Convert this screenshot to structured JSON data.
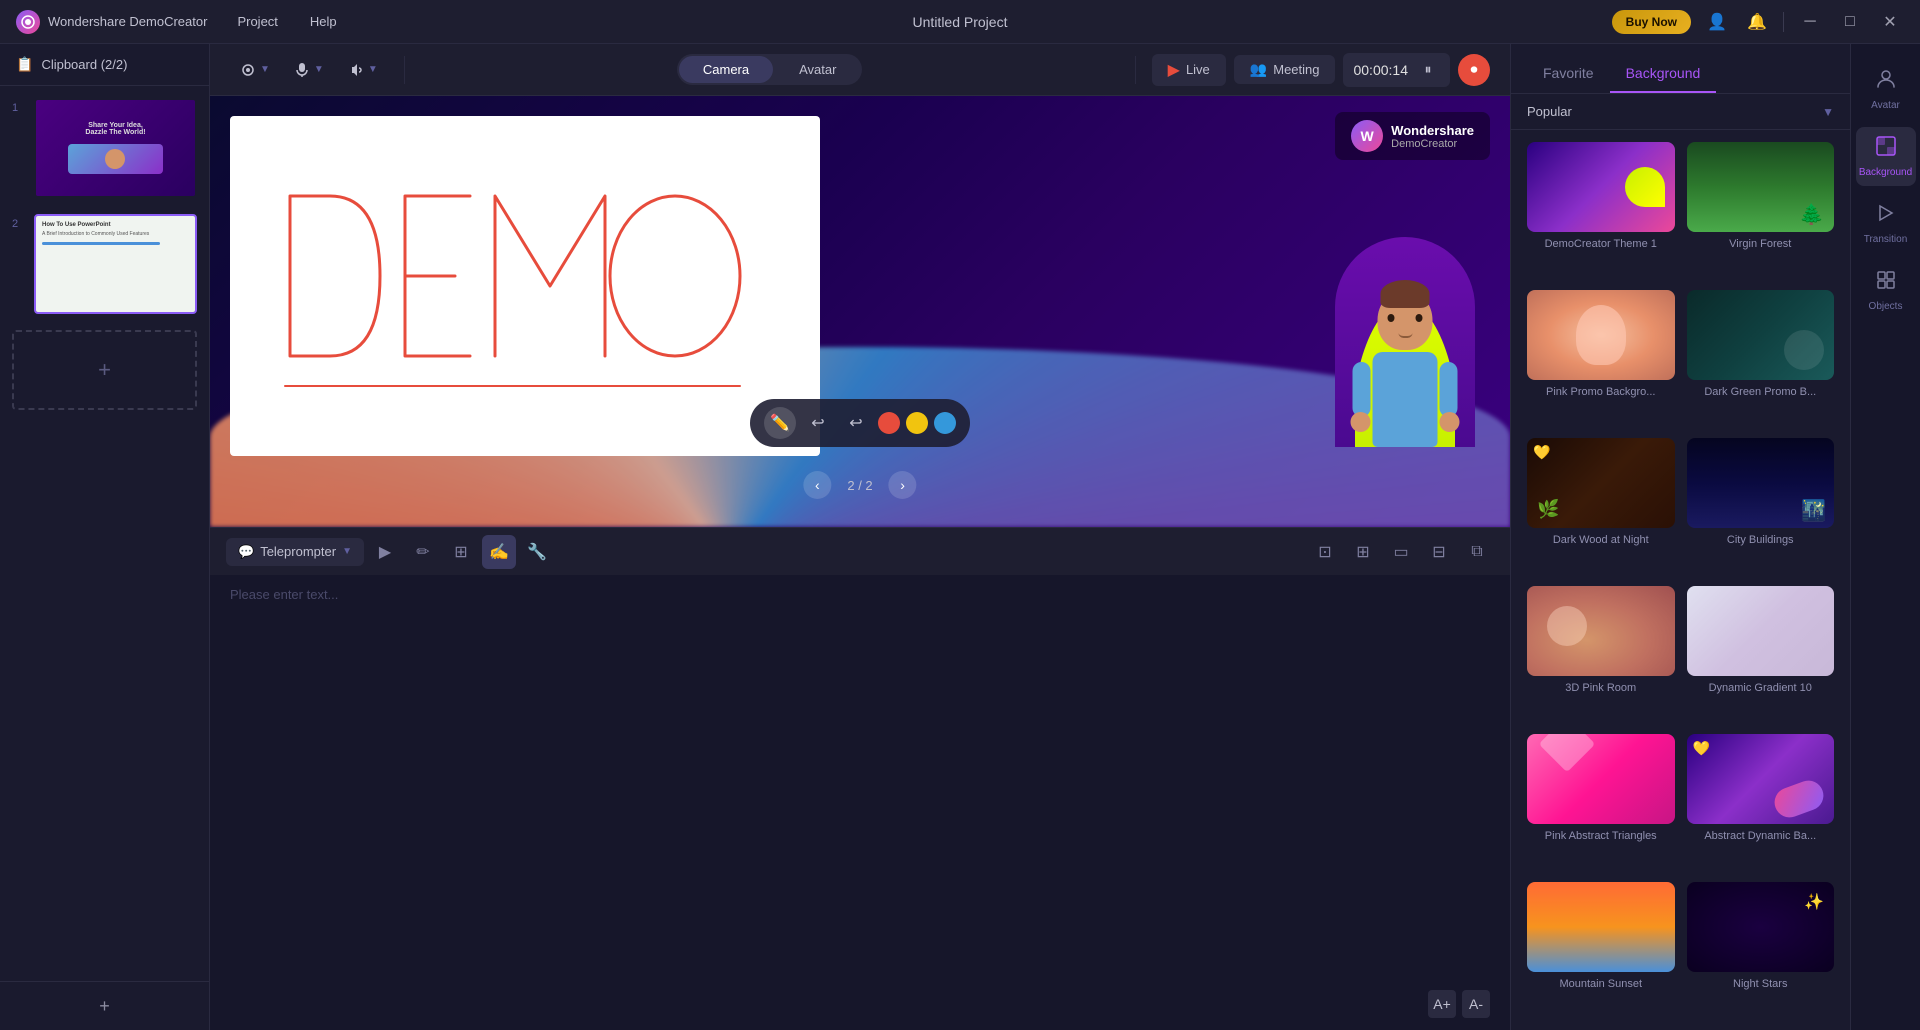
{
  "app": {
    "name": "Wondershare DemoCreator",
    "title": "Untitled Project",
    "logo_letter": "W"
  },
  "titlebar": {
    "menu": [
      "Project",
      "Help"
    ],
    "buy_label": "Buy Now",
    "window_buttons": [
      "minimize",
      "maximize",
      "close"
    ]
  },
  "toolbar": {
    "camera_label": "Camera",
    "avatar_label": "Avatar",
    "live_label": "Live",
    "meeting_label": "Meeting",
    "timer": "00:00:14"
  },
  "clipboard": {
    "title": "Clipboard (2/2)"
  },
  "slides": [
    {
      "num": "1",
      "title": "Share Your Idea, Dazzle The World!",
      "active": false
    },
    {
      "num": "2",
      "title": "How To Use PowerPoint",
      "active": true
    }
  ],
  "canvas": {
    "slide_counter": "2 / 2",
    "democreator_watermark_line1": "Wondershare",
    "democreator_watermark_line2": "DemoCreator"
  },
  "drawing_tools": {
    "tools": [
      "pen",
      "undo",
      "undo2"
    ],
    "colors": [
      "red",
      "yellow",
      "blue"
    ]
  },
  "teleprompter": {
    "label": "Teleprompter",
    "placeholder": "Please enter text...",
    "tools": [
      "pointer",
      "pen",
      "crop",
      "draw",
      "stamp"
    ]
  },
  "right_panel": {
    "tabs": [
      "Favorite",
      "Background"
    ],
    "active_tab": "Background",
    "dropdown_label": "Popular",
    "backgrounds": [
      {
        "id": "democreator-theme",
        "label": "DemoCreator Theme 1",
        "style": "democreator"
      },
      {
        "id": "virgin-forest",
        "label": "Virgin Forest",
        "style": "virgin-forest"
      },
      {
        "id": "pink-promo",
        "label": "Pink Promo Backgro...",
        "style": "pink-promo"
      },
      {
        "id": "dark-green-promo",
        "label": "Dark Green Promo B...",
        "style": "dark-green"
      },
      {
        "id": "dark-wood",
        "label": "Dark Wood at Night",
        "style": "dark-wood",
        "favorite": true
      },
      {
        "id": "city-buildings",
        "label": "City Buildings",
        "style": "city-buildings"
      },
      {
        "id": "3d-pink-room",
        "label": "3D Pink Room",
        "style": "3d-pink"
      },
      {
        "id": "dynamic-gradient",
        "label": "Dynamic Gradient 10",
        "style": "dynamic-gradient"
      },
      {
        "id": "pink-abstract",
        "label": "Pink Abstract Triangles",
        "style": "pink-abstract"
      },
      {
        "id": "abstract-dynamic",
        "label": "Abstract Dynamic Ba...",
        "style": "abstract-dynamic",
        "favorite": true
      },
      {
        "id": "mountain",
        "label": "Mountain Sunset",
        "style": "mountain"
      },
      {
        "id": "stars",
        "label": "Night Stars",
        "style": "stars"
      }
    ]
  },
  "right_sidebar": {
    "items": [
      {
        "id": "avatar",
        "label": "Avatar",
        "icon": "👤"
      },
      {
        "id": "background",
        "label": "Background",
        "icon": "🖼",
        "active": true
      },
      {
        "id": "transition",
        "label": "Transition",
        "icon": "▶"
      },
      {
        "id": "objects",
        "label": "Objects",
        "icon": "⬛"
      }
    ]
  }
}
